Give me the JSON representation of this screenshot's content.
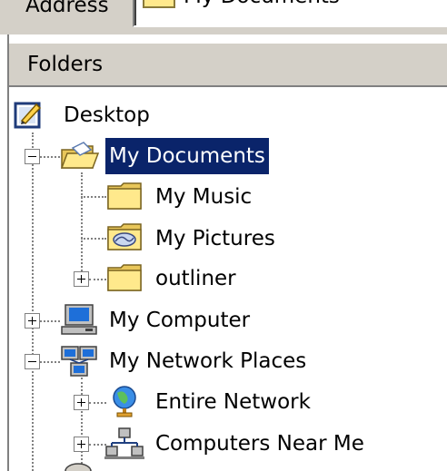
{
  "address_bar": {
    "label": "Address",
    "value": "My Documents"
  },
  "folders_pane": {
    "title": "Folders"
  },
  "tree": {
    "desktop": {
      "label": "Desktop",
      "icon": "desktop-icon"
    },
    "my_documents": {
      "label": "My Documents",
      "icon": "open-folder-icon",
      "expanded": true,
      "selected": true
    },
    "my_music": {
      "label": "My Music",
      "icon": "folder-icon"
    },
    "my_pictures": {
      "label": "My Pictures",
      "icon": "pictures-folder-icon"
    },
    "outliner": {
      "label": "outliner",
      "icon": "folder-icon",
      "expanded": false
    },
    "my_computer": {
      "label": "My Computer",
      "icon": "computer-icon",
      "expanded": false
    },
    "my_network_places": {
      "label": "My Network Places",
      "icon": "network-places-icon",
      "expanded": true
    },
    "entire_network": {
      "label": "Entire Network",
      "icon": "globe-icon",
      "expanded": false
    },
    "computers_near_me": {
      "label": "Computers Near Me",
      "icon": "workgroup-icon",
      "expanded": false
    }
  },
  "colors": {
    "chrome": "#d4d0c8",
    "selection": "#0a246a",
    "folder_yellow": "#ffe98c"
  }
}
